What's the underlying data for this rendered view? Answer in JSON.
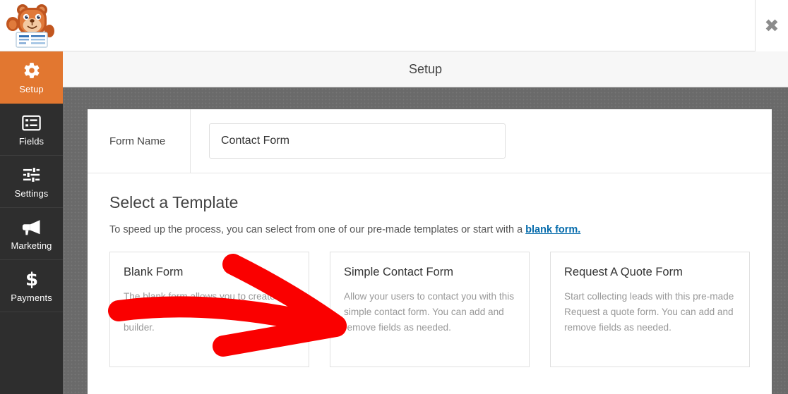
{
  "window": {
    "logo_icon": "wpforms-bear-mascot-logo",
    "close_label": "✖"
  },
  "sidebar": {
    "items": [
      {
        "label": "Setup",
        "icon": "gear-icon",
        "active": true
      },
      {
        "label": "Fields",
        "icon": "list-box-icon",
        "active": false
      },
      {
        "label": "Settings",
        "icon": "sliders-icon",
        "active": false
      },
      {
        "label": "Marketing",
        "icon": "megaphone-icon",
        "active": false
      },
      {
        "label": "Payments",
        "icon": "dollar-icon",
        "active": false
      }
    ]
  },
  "header": {
    "title": "Setup"
  },
  "form_name": {
    "label": "Form Name",
    "value": "Contact Form",
    "placeholder": "Form Name"
  },
  "templates": {
    "heading": "Select a Template",
    "subtitle_before": "To speed up the process, you can select from one of our pre-made templates or start with a ",
    "blank_form_link": "blank form.",
    "cards": [
      {
        "title": "Blank Form",
        "desc": "The blank form allows you to create any type of form using our drag & drop builder."
      },
      {
        "title": "Simple Contact Form",
        "desc": "Allow your users to contact you with this simple contact form. You can add and remove fields as needed."
      },
      {
        "title": "Request A Quote Form",
        "desc": "Start collecting leads with this pre-made Request a quote form. You can add and remove fields as needed."
      }
    ]
  },
  "annotation": {
    "type": "red-arrow",
    "color": "#fa0000",
    "points_to": "Simple Contact Form"
  },
  "colors": {
    "accent_orange": "#e27730",
    "sidebar_dark": "#2e2e2e",
    "canvas_gray": "#6a6a6a",
    "link_blue": "#036aab",
    "annotation_red": "#fa0000"
  }
}
